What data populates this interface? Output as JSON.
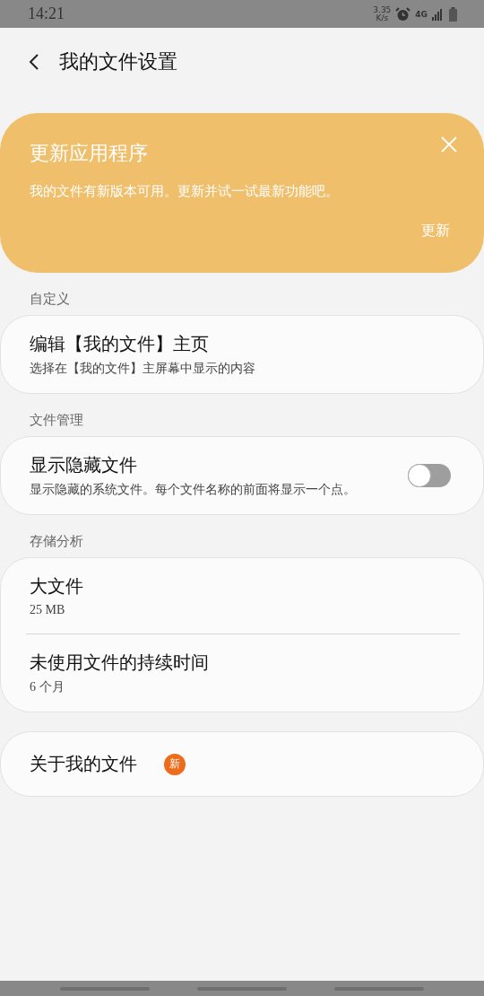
{
  "status_bar": {
    "time": "14:21",
    "speed_value": "3.35",
    "speed_unit": "K/s",
    "network": "4G"
  },
  "header": {
    "title": "我的文件设置"
  },
  "banner": {
    "title": "更新应用程序",
    "message": "我的文件有新版本可用。更新并试一试最新功能吧。",
    "action": "更新"
  },
  "sections": [
    {
      "heading": "自定义",
      "items": [
        {
          "kind": "link",
          "title": "编辑【我的文件】主页",
          "subtitle": "选择在【我的文件】主屏幕中显示的内容"
        }
      ]
    },
    {
      "heading": "文件管理",
      "items": [
        {
          "kind": "toggle",
          "title": "显示隐藏文件",
          "subtitle": "显示隐藏的系统文件。每个文件名称的前面将显示一个点。",
          "on": false
        }
      ]
    },
    {
      "heading": "存储分析",
      "items": [
        {
          "kind": "link",
          "title": "大文件",
          "subtitle": "25 MB"
        },
        {
          "kind": "link",
          "title": "未使用文件的持续时间",
          "subtitle": "6 个月"
        }
      ]
    }
  ],
  "about": {
    "title": "关于我的文件",
    "badge": "新"
  }
}
